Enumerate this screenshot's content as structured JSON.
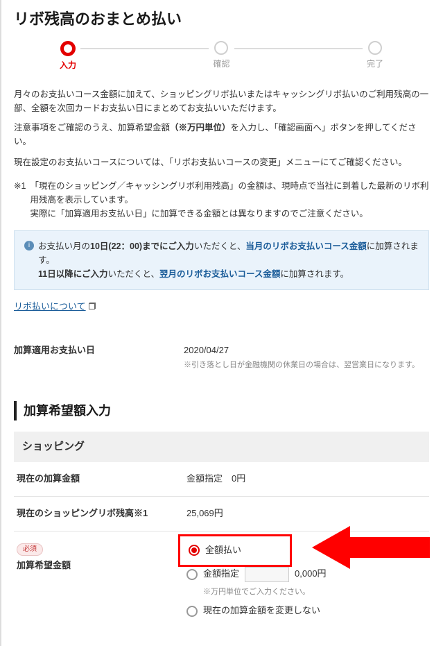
{
  "page": {
    "title": "リボ残高のおまとめ払い"
  },
  "stepper": {
    "steps": [
      {
        "label": "入力",
        "active": true
      },
      {
        "label": "確認",
        "active": false
      },
      {
        "label": "完了",
        "active": false
      }
    ]
  },
  "intro": {
    "p1": "月々のお支払いコース金額に加えて、ショッピングリボ払いまたはキャッシングリボ払いのご利用残高の一部、全額を次回カードお支払い日にまとめてお支払いいただけます。",
    "p2_pre": "注意事項をご確認のうえ、加算希望金額",
    "p2_strong": "（※万円単位）",
    "p2_post": "を入力し、「確認画面へ」ボタンを押してください。",
    "p3": "現在設定のお支払いコースについては、「リボお支払いコースの変更」メニューにてご確認ください。"
  },
  "notes": {
    "n1_label": "※1",
    "n1_l1": "「現在のショッピング／キャッシングリボ利用残高」の金額は、現時点で当社に到着した最新のリボ利用残高を表示しています。",
    "n1_l2": "実際に「加算適用お支払い日」に加算できる金額とは異なりますのでご注意ください。"
  },
  "info": {
    "l1_pre": "お支払い月の",
    "l1_bold1": "10日(22：00)までにご入力",
    "l1_mid": "いただくと、",
    "l1_hi1": "当月のリボお支払いコース金額",
    "l1_post": "に加算されます。",
    "l2_bold": "11日以降にご入力",
    "l2_mid": "いただくと、",
    "l2_hi": "翌月のリボお支払いコース金額",
    "l2_post": "に加算されます。"
  },
  "link": {
    "about_revo": "リボ払いについて"
  },
  "apply_date": {
    "label": "加算適用お支払い日",
    "value": "2020/04/27",
    "note": "※引き落とし日が金融機関の休業日の場合は、翌営業日になります。"
  },
  "section": {
    "heading": "加算希望額入力"
  },
  "shopping": {
    "heading": "ショッピング",
    "current_add_label": "現在の加算金額",
    "current_add_value": "金額指定　0円",
    "balance_label": "現在のショッピングリボ残高※1",
    "balance_value": "25,069円",
    "wish_badge": "必須",
    "wish_label": "加算希望金額",
    "radio_full": "全額払い",
    "radio_amount": "金額指定",
    "amount_suffix": "0,000円",
    "amount_note": "※万円単位でご入力ください。",
    "radio_nochange": "現在の加算金額を変更しない"
  }
}
